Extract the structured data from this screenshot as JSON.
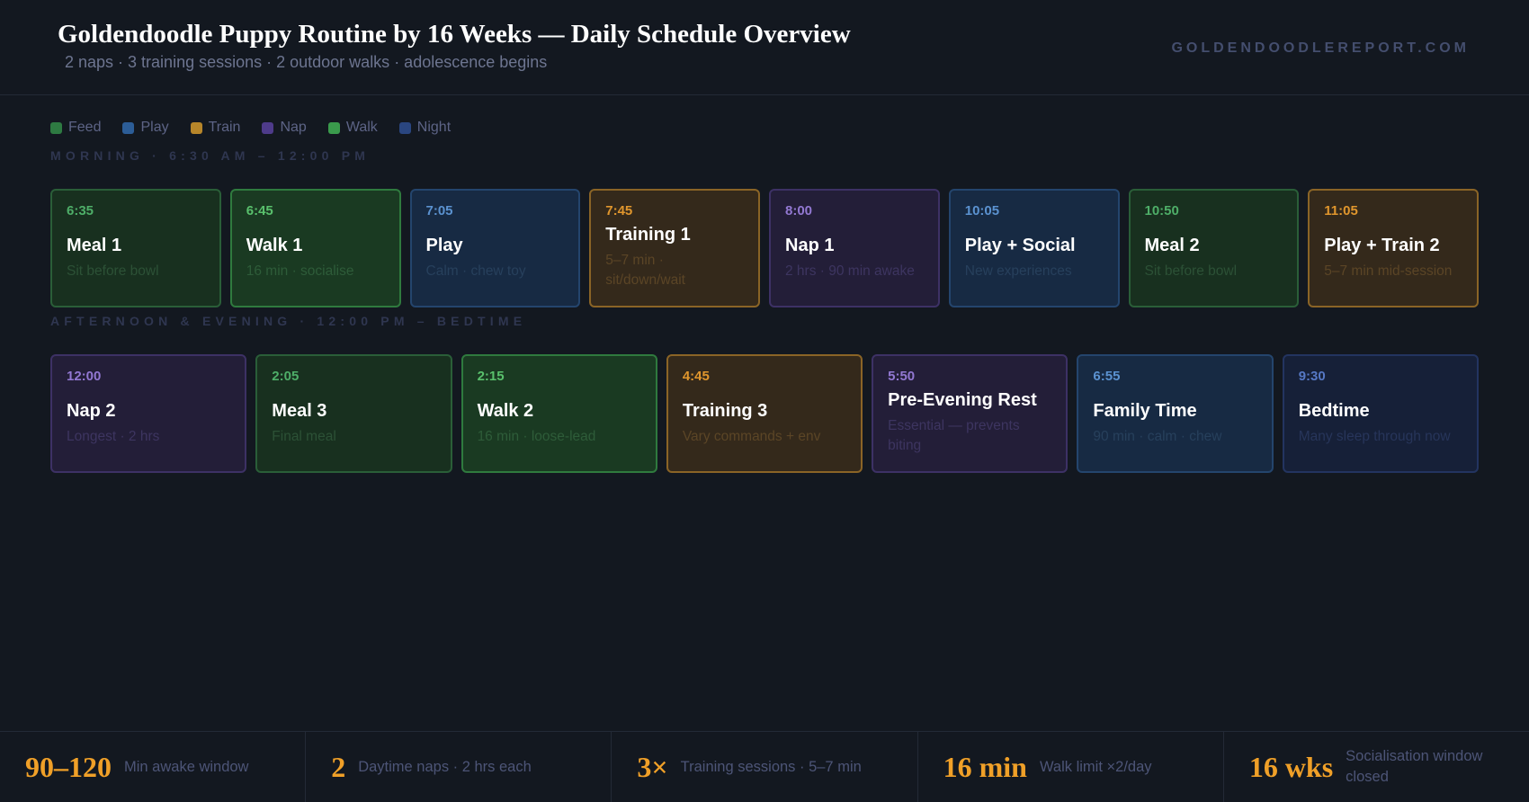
{
  "header": {
    "title": "Goldendoodle Puppy Routine by 16 Weeks — Daily Schedule Overview",
    "subtitle": "2 naps · 3 training sessions · 2 outdoor walks · adolescence begins",
    "brand": "GOLDENDOODLEREPORT.COM"
  },
  "colors": {
    "feed": "#2e7a42",
    "play": "#2c5d97",
    "train": "#b7862a",
    "nap": "#4e3b8a",
    "walk": "#3a9a4c",
    "night": "#2a4680",
    "accent": "#f0a028"
  },
  "legend": [
    {
      "label": "Feed",
      "category": "feed"
    },
    {
      "label": "Play",
      "category": "play"
    },
    {
      "label": "Train",
      "category": "train"
    },
    {
      "label": "Nap",
      "category": "nap"
    },
    {
      "label": "Walk",
      "category": "walk"
    },
    {
      "label": "Night",
      "category": "night"
    }
  ],
  "sections": {
    "morning": {
      "label": "MORNING · 6:30 AM – 12:00 PM",
      "cards": [
        {
          "time": "6:35",
          "title": "Meal 1",
          "desc": "Sit before bowl",
          "category": "feed"
        },
        {
          "time": "6:45",
          "title": "Walk 1",
          "desc": "16 min · socialise",
          "category": "walk"
        },
        {
          "time": "7:05",
          "title": "Play",
          "desc": "Calm · chew toy",
          "category": "play"
        },
        {
          "time": "7:45",
          "title": "Training 1",
          "desc": "5–7 min · sit/down/wait",
          "category": "train"
        },
        {
          "time": "8:00",
          "title": "Nap 1",
          "desc": "2 hrs · 90 min awake",
          "category": "nap"
        },
        {
          "time": "10:05",
          "title": "Play + Social",
          "desc": "New experiences",
          "category": "play"
        },
        {
          "time": "10:50",
          "title": "Meal 2",
          "desc": "Sit before bowl",
          "category": "feed"
        },
        {
          "time": "11:05",
          "title": "Play + Train 2",
          "desc": "5–7 min mid-session",
          "category": "train"
        }
      ]
    },
    "evening": {
      "label": "AFTERNOON & EVENING · 12:00 PM – BEDTIME",
      "cards": [
        {
          "time": "12:00",
          "title": "Nap 2",
          "desc": "Longest · 2 hrs",
          "category": "nap"
        },
        {
          "time": "2:05",
          "title": "Meal 3",
          "desc": "Final meal",
          "category": "feed"
        },
        {
          "time": "2:15",
          "title": "Walk 2",
          "desc": "16 min · loose-lead",
          "category": "walk"
        },
        {
          "time": "4:45",
          "title": "Training 3",
          "desc": "Vary commands + env",
          "category": "train"
        },
        {
          "time": "5:50",
          "title": "Pre-Evening Rest",
          "desc": "Essential — prevents biting",
          "category": "nap"
        },
        {
          "time": "6:55",
          "title": "Family Time",
          "desc": "90 min · calm · chew",
          "category": "play"
        },
        {
          "time": "9:30",
          "title": "Bedtime",
          "desc": "Many sleep through now",
          "category": "night"
        }
      ]
    }
  },
  "stats": [
    {
      "value": "90–120",
      "label": "Min awake window"
    },
    {
      "value": "2",
      "label": "Daytime naps · 2 hrs each"
    },
    {
      "value": "3×",
      "label": "Training sessions · 5–7 min"
    },
    {
      "value": "16 min",
      "label": "Walk limit ×2/day"
    },
    {
      "value": "16 wks",
      "label": "Socialisation window closed"
    }
  ]
}
